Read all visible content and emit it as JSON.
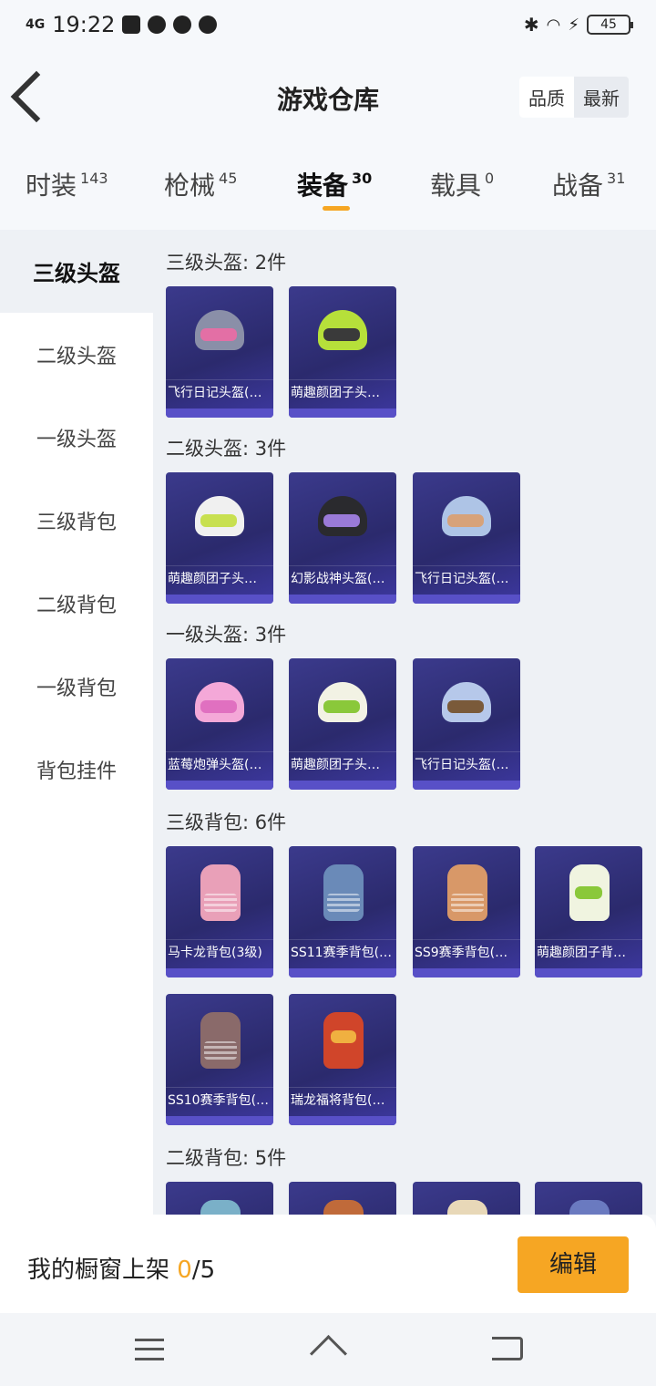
{
  "status": {
    "network": "4G",
    "time": "19:22",
    "battery": "45"
  },
  "header": {
    "title": "游戏仓库",
    "sort_options": [
      "品质",
      "最新"
    ]
  },
  "tabs": [
    {
      "label": "时装",
      "count": "143"
    },
    {
      "label": "枪械",
      "count": "45"
    },
    {
      "label": "装备",
      "count": "30"
    },
    {
      "label": "载具",
      "count": "0"
    },
    {
      "label": "战备",
      "count": "31"
    }
  ],
  "sidebar": {
    "items": [
      "三级头盔",
      "二级头盔",
      "一级头盔",
      "三级背包",
      "二级背包",
      "一级背包",
      "背包挂件"
    ]
  },
  "sections": [
    {
      "title": "三级头盔: 2件",
      "items": [
        "飞行日记头盔(…",
        "萌趣颜团子头…"
      ]
    },
    {
      "title": "二级头盔: 3件",
      "items": [
        "萌趣颜团子头…",
        "幻影战神头盔(…",
        "飞行日记头盔(…"
      ]
    },
    {
      "title": "一级头盔: 3件",
      "items": [
        "蓝莓炮弹头盔(…",
        "萌趣颜团子头…",
        "飞行日记头盔(…"
      ]
    },
    {
      "title": "三级背包: 6件",
      "items": [
        "马卡龙背包(3级)",
        "SS11赛季背包(…",
        "SS9赛季背包(…",
        "萌趣颜团子背…",
        "SS10赛季背包(…",
        "瑞龙福将背包(…"
      ]
    },
    {
      "title": "二级背包: 5件",
      "items": [
        "",
        "",
        "",
        ""
      ]
    }
  ],
  "bottom": {
    "showcase_prefix": "我的橱窗上架 ",
    "showcase_count": "0",
    "showcase_total": "/5",
    "edit_label": "编辑"
  },
  "colors": {
    "accent": "#f6a623",
    "card_bg": "#2b2a6d"
  }
}
